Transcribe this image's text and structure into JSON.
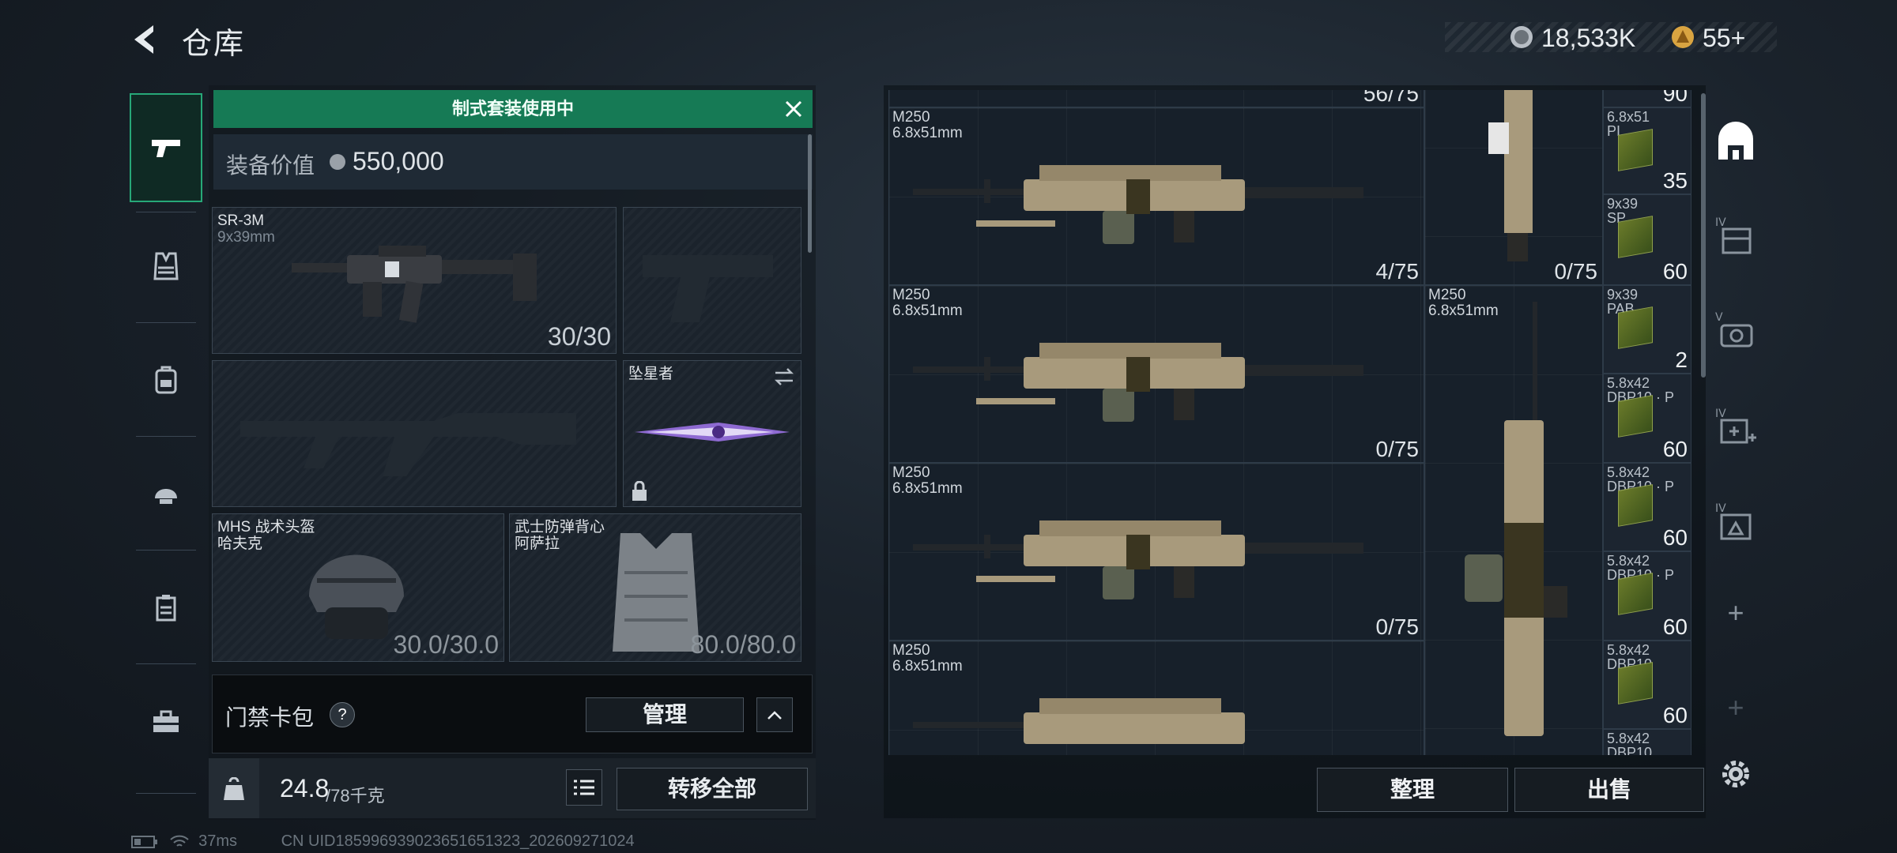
{
  "header": {
    "title": "仓库",
    "currency": [
      {
        "icon": "silver-coin-icon",
        "value": "18,533K"
      },
      {
        "icon": "gold-coin-icon",
        "value": "55+"
      }
    ]
  },
  "categories": [
    {
      "icon": "pistol-icon",
      "active": true
    },
    {
      "icon": "vest-icon"
    },
    {
      "icon": "backpack-icon"
    },
    {
      "icon": "helmet-icon"
    },
    {
      "icon": "clipboard-icon"
    },
    {
      "icon": "toolbox-icon"
    }
  ],
  "loadout": {
    "banner": "制式套装使用中",
    "value_label": "装备价值",
    "value": "550,000",
    "primary": {
      "name": "SR-3M",
      "caliber": "9x39mm",
      "count": "30/30"
    },
    "melee": {
      "name": "坠星者"
    },
    "helmet": {
      "name": "MHS 战术头盔",
      "sub": "哈夫克",
      "durability": "30.0/30.0"
    },
    "armor": {
      "name": "武士防弹背心",
      "sub": "阿萨拉",
      "durability": "80.0/80.0"
    },
    "keycard": {
      "label": "门禁卡包",
      "help": "?",
      "manage": "管理"
    },
    "weight": {
      "current": "24.8",
      "max": "/78千克"
    },
    "transfer_all": "转移全部"
  },
  "stash": {
    "top_partial_count": "56/75",
    "top_partial_ammo": "90",
    "weapons": [
      {
        "name": "M250",
        "caliber": "6.8x51mm",
        "count": "4/75"
      },
      {
        "name": "M250",
        "caliber": "6.8x51mm",
        "count": "0/75"
      },
      {
        "name": "M250",
        "caliber": "6.8x51mm",
        "count": "0/75"
      },
      {
        "name": "M250",
        "caliber": "6.8x51mm",
        "count": ""
      }
    ],
    "vertical_top": {
      "count": "0/75"
    },
    "vertical_weapon": {
      "name": "M250",
      "caliber": "6.8x51mm"
    },
    "ammo": [
      {
        "name": "6.8x51",
        "sub": "PI",
        "count": "35"
      },
      {
        "name": "9x39",
        "sub": "SP",
        "count": "60"
      },
      {
        "name": "9x39",
        "sub": "PAB",
        "count": "2"
      },
      {
        "name": "5.8x42",
        "sub": "DBP10 · P",
        "count": "60"
      },
      {
        "name": "5.8x42",
        "sub": "DBP10 · P",
        "count": "60"
      },
      {
        "name": "5.8x42",
        "sub": "DBP10 · P",
        "count": "60"
      },
      {
        "name": "5.8x42",
        "sub": "DBP10",
        "count": "60"
      },
      {
        "name": "5.8x42",
        "sub": "DBP10",
        "count": ""
      }
    ],
    "organize": "整理",
    "sell": "出售"
  },
  "right_tabs": [
    {
      "icon": "stash-home-icon",
      "label": ""
    },
    {
      "icon": "storage-tab-icon",
      "label": "IV"
    },
    {
      "icon": "storage-tab-icon",
      "label": "V"
    },
    {
      "icon": "storage-tab-icon",
      "label": "IV"
    },
    {
      "icon": "storage-tab-icon",
      "label": "IV"
    },
    {
      "icon": "add-tab-icon",
      "label": "+"
    },
    {
      "icon": "add-tab-icon",
      "label": "+"
    }
  ],
  "status": {
    "ping": "37ms",
    "uid": "CN UID185996939023651651323_202609271024"
  },
  "colors": {
    "accent_green": "#167a55",
    "active_border": "#27a878"
  }
}
